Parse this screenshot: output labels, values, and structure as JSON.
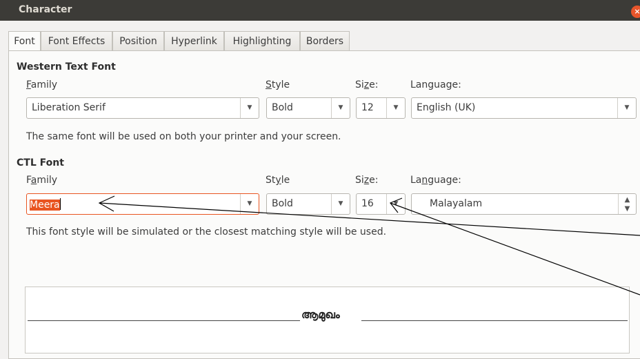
{
  "window": {
    "title": "Character",
    "close_glyph": "×"
  },
  "tabs": [
    {
      "label": "Font",
      "active": true
    },
    {
      "label": "Font Effects"
    },
    {
      "label": "Position"
    },
    {
      "label": "Hyperlink"
    },
    {
      "label": "Highlighting"
    },
    {
      "label": "Borders"
    }
  ],
  "western": {
    "heading": "Western Text Font",
    "family_label": "Family",
    "style_label": "Style",
    "size_label": "Size:",
    "language_label": "Language:",
    "family_value": "Liberation Serif",
    "style_value": "Bold",
    "size_value": "12",
    "language_value": "English (UK)",
    "info": "The same font will be used on both your printer and your screen."
  },
  "ctl": {
    "heading": "CTL Font",
    "family_label": "Family",
    "style_label": "Style",
    "size_label": "Size:",
    "language_label": "Language:",
    "family_value": "Meera",
    "style_value": "Bold",
    "size_value": "16",
    "language_value": "Malayalam",
    "info": "This font style will be simulated or the closest matching style will be used."
  },
  "preview": {
    "sample_text": "ആമുഖം"
  },
  "icons": {
    "dropdown": "▼",
    "spin_up": "▲",
    "spin_down": "▼"
  },
  "colors": {
    "titlebar": "#3c3b37",
    "selection": "#e95420",
    "close": "#e8552b"
  }
}
